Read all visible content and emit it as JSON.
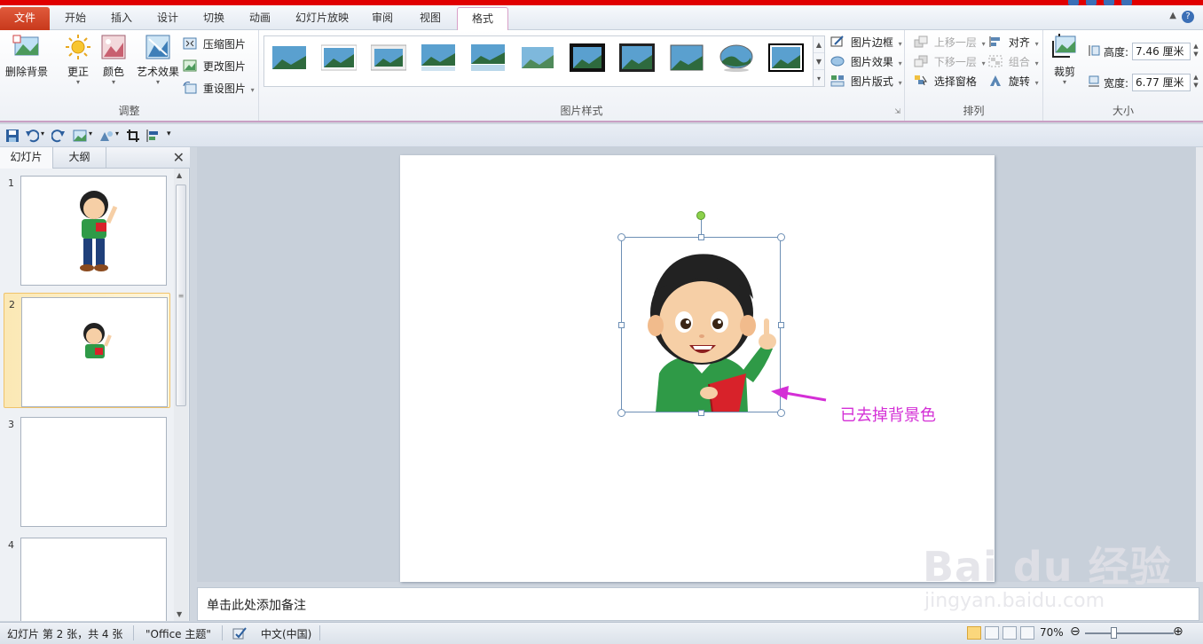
{
  "tabs": [
    "文件",
    "开始",
    "插入",
    "设计",
    "切换",
    "动画",
    "幻灯片放映",
    "审阅",
    "视图",
    "格式"
  ],
  "active_tab": "格式",
  "ribbon": {
    "adjust": {
      "remove_bg": "删除背景",
      "correct": "更正",
      "color": "颜色",
      "artistic": "艺术效果",
      "compress": "压缩图片",
      "change": "更改图片",
      "reset": "重设图片",
      "group_label": "调整"
    },
    "styles": {
      "border": "图片边框",
      "effects": "图片效果",
      "layout": "图片版式",
      "group_label": "图片样式"
    },
    "arrange": {
      "bring_forward": "上移一层",
      "send_backward": "下移一层",
      "selection_pane": "选择窗格",
      "align": "对齐",
      "group": "组合",
      "rotate": "旋转",
      "group_label": "排列"
    },
    "size": {
      "crop": "裁剪",
      "height_label": "高度:",
      "height_value": "7.46 厘米",
      "width_label": "宽度:",
      "width_value": "6.77 厘米",
      "group_label": "大小"
    }
  },
  "panel": {
    "tab_slides": "幻灯片",
    "tab_outline": "大纲",
    "close": "✕",
    "slides": [
      {
        "num": "1",
        "has_image": true,
        "image_size": "large"
      },
      {
        "num": "2",
        "has_image": true,
        "image_size": "small",
        "selected": true
      },
      {
        "num": "3",
        "has_image": false
      },
      {
        "num": "4",
        "has_image": false
      }
    ]
  },
  "slide": {
    "annotation": "已去掉背景色",
    "annotation_color": "#d42fd6"
  },
  "notes_placeholder": "单击此处添加备注",
  "status": {
    "slide_info": "幻灯片 第 2 张，共 4 张",
    "theme": "\"Office 主题\"",
    "language": "中文(中国)",
    "zoom": "70%"
  },
  "watermark": {
    "main": "Bai du 经验",
    "sub": "jingyan.baidu.com"
  },
  "colors": {
    "accent_file_tab": "#c8391c",
    "ribbon_border": "#c9a0c4",
    "selection": "#6d8fb5",
    "rotate_handle": "#8cd14b"
  }
}
